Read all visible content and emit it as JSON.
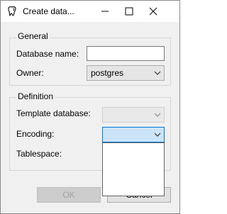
{
  "window": {
    "title": "Create data...",
    "icon": "pgadmin-elephant-icon",
    "controls": {
      "minimize": "minimize-icon",
      "maximize": "maximize-icon",
      "close": "close-icon"
    }
  },
  "general": {
    "title": "General",
    "database_name_label": "Database name:",
    "database_name_value": "",
    "owner_label": "Owner:",
    "owner_value": "postgres"
  },
  "definition": {
    "title": "Definition",
    "template_label": "Template database:",
    "template_value": "",
    "encoding_label": "Encoding:",
    "encoding_value": "",
    "tablespace_label": "Tablespace:"
  },
  "buttons": {
    "ok": "OK",
    "cancel": "Cancel"
  },
  "colors": {
    "focus_accent": "#0078d7",
    "focus_fill": "#cce4f7"
  }
}
